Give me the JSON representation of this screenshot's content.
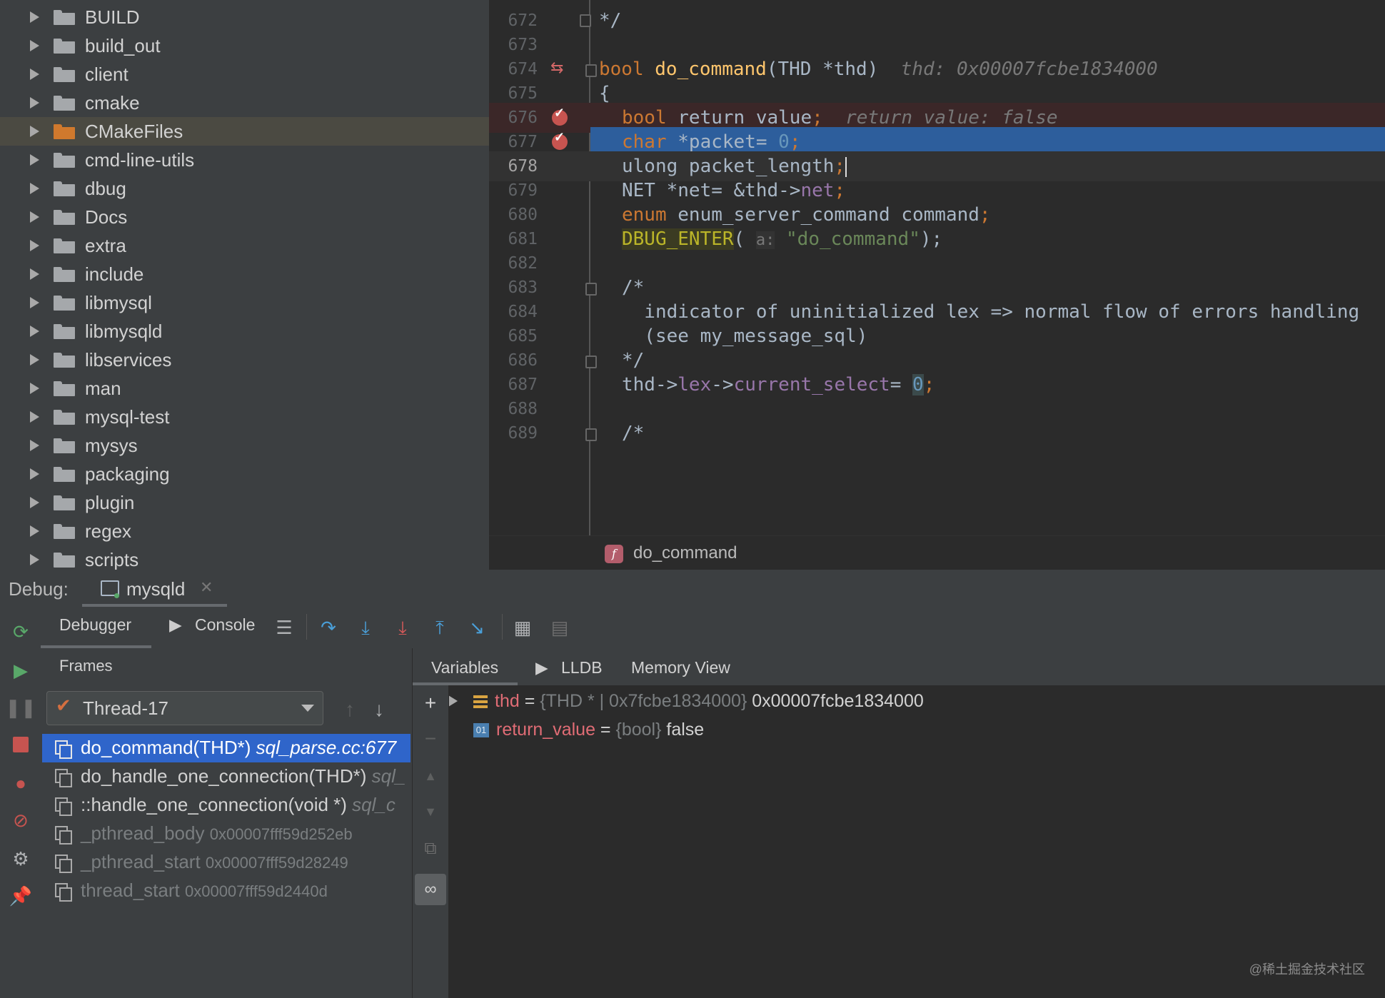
{
  "project_tree": {
    "folders": [
      {
        "name": "BUILD",
        "selected": false
      },
      {
        "name": "build_out",
        "selected": false
      },
      {
        "name": "client",
        "selected": false
      },
      {
        "name": "cmake",
        "selected": false
      },
      {
        "name": "CMakeFiles",
        "selected": true
      },
      {
        "name": "cmd-line-utils",
        "selected": false
      },
      {
        "name": "dbug",
        "selected": false
      },
      {
        "name": "Docs",
        "selected": false
      },
      {
        "name": "extra",
        "selected": false
      },
      {
        "name": "include",
        "selected": false
      },
      {
        "name": "libmysql",
        "selected": false
      },
      {
        "name": "libmysqld",
        "selected": false
      },
      {
        "name": "libservices",
        "selected": false
      },
      {
        "name": "man",
        "selected": false
      },
      {
        "name": "mysql-test",
        "selected": false
      },
      {
        "name": "mysys",
        "selected": false
      },
      {
        "name": "packaging",
        "selected": false
      },
      {
        "name": "plugin",
        "selected": false
      },
      {
        "name": "regex",
        "selected": false
      },
      {
        "name": "scripts",
        "selected": false
      }
    ]
  },
  "editor": {
    "line_numbers": [
      "672",
      "673",
      "674",
      "675",
      "676",
      "677",
      "678",
      "679",
      "680",
      "681",
      "682",
      "683",
      "684",
      "685",
      "686",
      "687",
      "688",
      "689"
    ],
    "current_line": "678",
    "breakpoint_lines": [
      "676",
      "677"
    ],
    "execution_line": "677",
    "tokens": {
      "l672": "*/",
      "l674_kw": "bool",
      "l674_fn": "do_command",
      "l674_rest": "(THD *thd)",
      "l674_hint": "thd: 0x00007fcbe1834000",
      "l675": "{",
      "l676_kw": "bool",
      "l676_rest": " return_value",
      "l676_semi": ";",
      "l676_hint": "return_value: false",
      "l677_kw": "char",
      "l677_rest": " *packet= ",
      "l677_num": "0",
      "l677_semi": ";",
      "l678_rest": "ulong packet_length",
      "l678_semi": ";",
      "l679_a": "NET *net= &thd->",
      "l679_f": "net",
      "l679_semi": ";",
      "l680_kw": "enum",
      "l680_rest": " enum_server_command command",
      "l680_semi": ";",
      "l681_macro": "DBUG_ENTER",
      "l681_paren": "(",
      "l681_param": "a:",
      "l681_str": "\"do_command\"",
      "l681_end": ");",
      "l683": "/*",
      "l684": "  indicator of uninitialized lex => normal flow of errors handling",
      "l685": "  (see my_message_sql)",
      "l686": "*/",
      "l687_a": "thd->",
      "l687_f1": "lex",
      "l687_b": "->",
      "l687_f2": "current_select",
      "l687_c": "= ",
      "l687_num": "0",
      "l687_semi": ";",
      "l689": "/*"
    }
  },
  "breadcrumb": {
    "icon": "function-icon",
    "icon_letter": "f",
    "label": "do_command"
  },
  "debug": {
    "label": "Debug:",
    "session_tab": "mysqld",
    "tabs": {
      "debugger": "Debugger",
      "console": "Console"
    },
    "frames_header": "Frames",
    "thread": "Thread-17",
    "frames": [
      {
        "name": "do_command(THD*)",
        "loc": "sql_parse.cc:677",
        "selected": true,
        "dim": false
      },
      {
        "name": "do_handle_one_connection(THD*)",
        "loc": "sql_",
        "selected": false,
        "dim": false
      },
      {
        "name": "::handle_one_connection(void *)",
        "loc": "sql_c",
        "selected": false,
        "dim": false
      },
      {
        "name": "_pthread_body",
        "addr": "0x00007fff59d252eb",
        "selected": false,
        "dim": true
      },
      {
        "name": "_pthread_start",
        "addr": "0x00007fff59d28249",
        "selected": false,
        "dim": true
      },
      {
        "name": "thread_start",
        "addr": "0x00007fff59d2440d",
        "selected": false,
        "dim": true
      }
    ],
    "var_tabs": {
      "variables": "Variables",
      "lldb": "LLDB",
      "memory": "Memory View"
    },
    "variables": [
      {
        "name": "thd",
        "eq": " = ",
        "type": "{THD * | 0x7fcbe1834000}",
        "value": " 0x00007fcbe1834000",
        "expandable": true
      },
      {
        "name": "return_value",
        "eq": " = ",
        "type": "{bool}",
        "value": " false",
        "expandable": false
      }
    ]
  },
  "watermark": "@稀土掘金技术社区",
  "colors": {
    "breakpoint": "#c75450",
    "execution_line": "#2d5e9c",
    "selected_frame": "#2f65ca",
    "selected_folder": "#4b4a42"
  }
}
